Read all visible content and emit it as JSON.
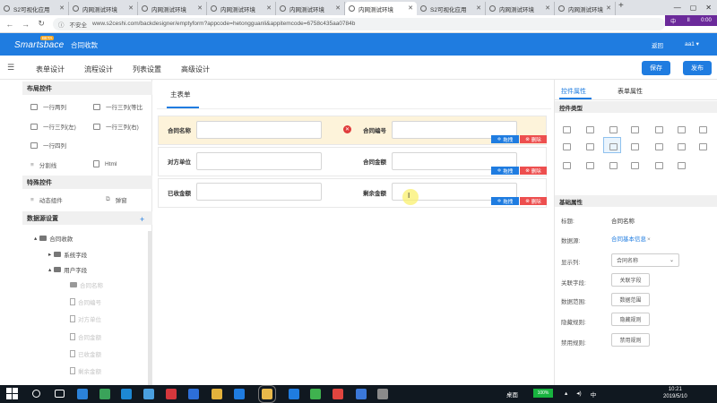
{
  "browser": {
    "tabs": [
      {
        "label": "S2可视化应用"
      },
      {
        "label": "内网测试环境"
      },
      {
        "label": "内网测试环境"
      },
      {
        "label": "内网测试环境"
      },
      {
        "label": "内网测试环境"
      },
      {
        "label": "内网测试环境"
      },
      {
        "label": "S2可视化应用"
      },
      {
        "label": "内网测试环境"
      },
      {
        "label": "内网测试环境"
      }
    ],
    "active_tab": 5,
    "new_tab": "+",
    "insecure_label": "不安全",
    "url": "www.s2ceshi.com/backdesigner/emptyform?appcode=hetongguanli&appitemcode=6758c435aa0784b",
    "sys_badge": [
      "中",
      "II",
      "0:00"
    ]
  },
  "app": {
    "logo": "Smartsbace",
    "logo_badge": "BETA",
    "title": "合同收款",
    "return_label": "返回",
    "user_label": "aa1 ▾"
  },
  "toolbar": {
    "tabs": [
      "表单设计",
      "流程设计",
      "列表设置",
      "高级设计"
    ],
    "save_label": "保存",
    "publish_label": "发布"
  },
  "left": {
    "layout_header": "布局控件",
    "layout_items": [
      "一行两列",
      "一行三列(等比",
      "一行三列(左)",
      "一行三列(右)",
      "一行四列",
      "分割线",
      "Html"
    ],
    "special_header": "特殊控件",
    "special_items": [
      "动态组件",
      "弹窗"
    ],
    "datasource_header": "数据源设置",
    "plus": "+",
    "tree": {
      "root": "合同收款",
      "system": "系统字段",
      "user": "用户字段",
      "fields": [
        "合同名称",
        "合同编号",
        "对方单位",
        "合同金额",
        "已收金额",
        "剩余金额"
      ]
    }
  },
  "form": {
    "tab_label": "主表单",
    "fields": [
      {
        "label": "合同名称",
        "value": ""
      },
      {
        "label": "合同编号",
        "value": ""
      },
      {
        "label": "对方单位",
        "value": ""
      },
      {
        "label": "合同金额",
        "value": ""
      },
      {
        "label": "已收金额",
        "value": ""
      },
      {
        "label": "剩余金额",
        "value": ""
      }
    ],
    "drag_label": "拖拽",
    "delete_label": "删除",
    "cursor_glyph": "I"
  },
  "right": {
    "tabs": [
      "控件属性",
      "表单属性"
    ],
    "type_header": "控件类型",
    "basic_header": "基础属性",
    "props": {
      "label_title": "标题:",
      "label_value": "合同名称",
      "ds_title": "数据源:",
      "ds_value": "合同基本信息",
      "ds_clear": "×",
      "display_title": "显示列:",
      "display_value": "合同名称",
      "link_title": "关联字段:",
      "link_btn": "关联字段",
      "range_title": "数据范围:",
      "range_btn": "数据范围",
      "hide_title": "隐藏规则:",
      "hide_btn": "隐藏规则",
      "disable_title": "禁用规则:",
      "disable_btn": "禁用规则"
    }
  },
  "taskbar": {
    "desktop_label": "桌面",
    "battery_label": "100%",
    "ime_label": "中",
    "clock_time": "10:21",
    "clock_date": "2019/5/10"
  },
  "colors": {
    "primary": "#1f7ce0",
    "danger": "#ed4f4f",
    "selected_row": "#fdf3da"
  }
}
